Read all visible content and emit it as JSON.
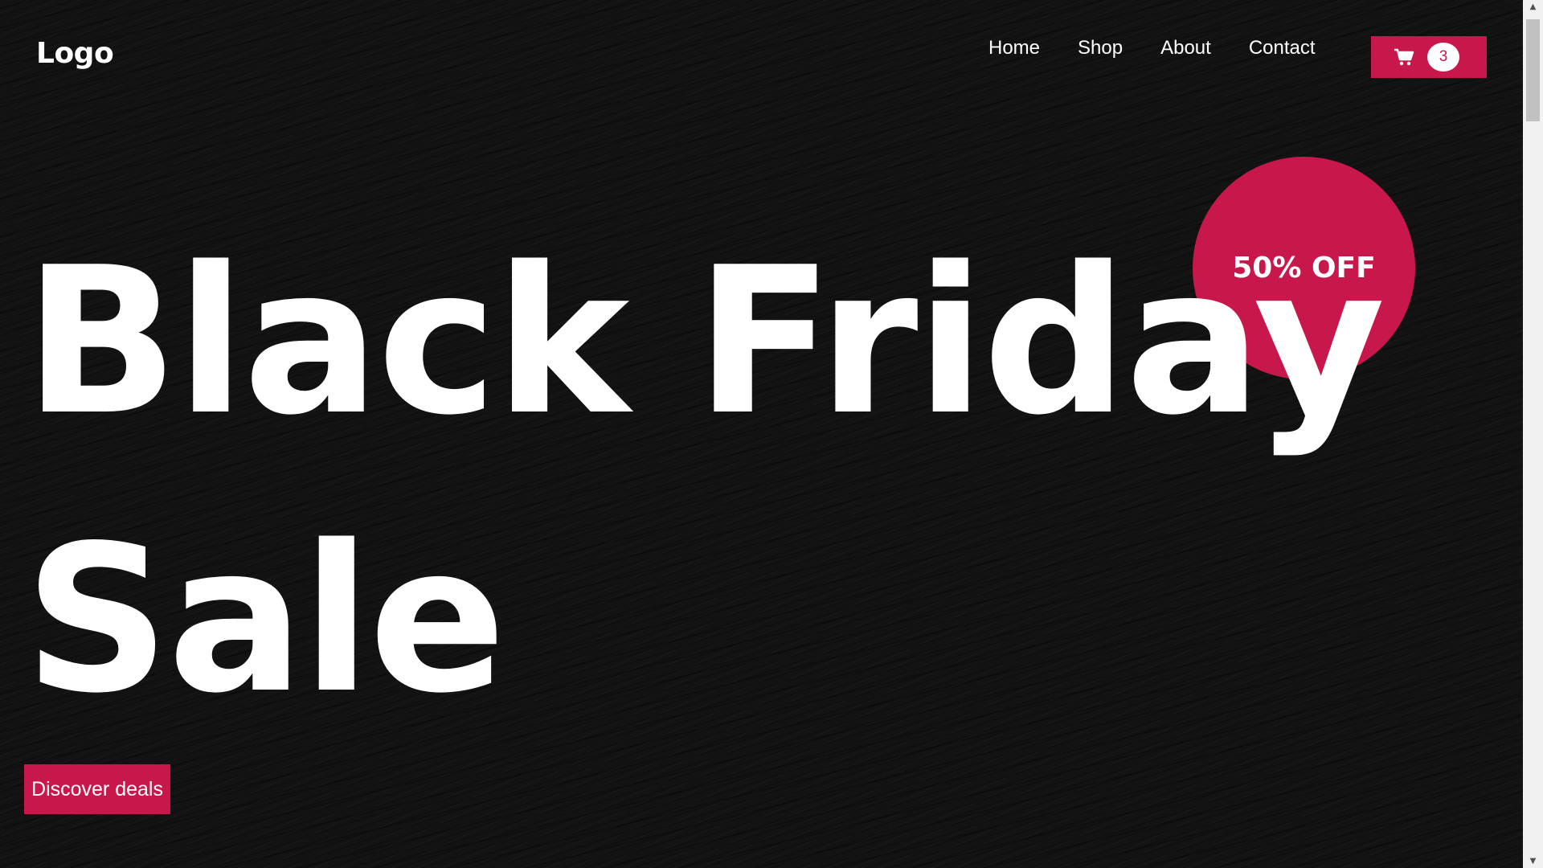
{
  "header": {
    "logo": "Logo",
    "nav": [
      "Home",
      "Shop",
      "About",
      "Contact"
    ],
    "cart": {
      "icon": "cart-icon",
      "count": "3"
    }
  },
  "badge": {
    "text": "50% OFF"
  },
  "hero": {
    "line1": "Black Friday",
    "line2": "Sale",
    "cta": "Discover deals"
  },
  "colors": {
    "accent": "#c8184b",
    "background": "#131313",
    "text": "#ffffff"
  },
  "scrollbar": {
    "up_icon": "chevron-up-icon",
    "down_icon": "chevron-down-icon"
  }
}
